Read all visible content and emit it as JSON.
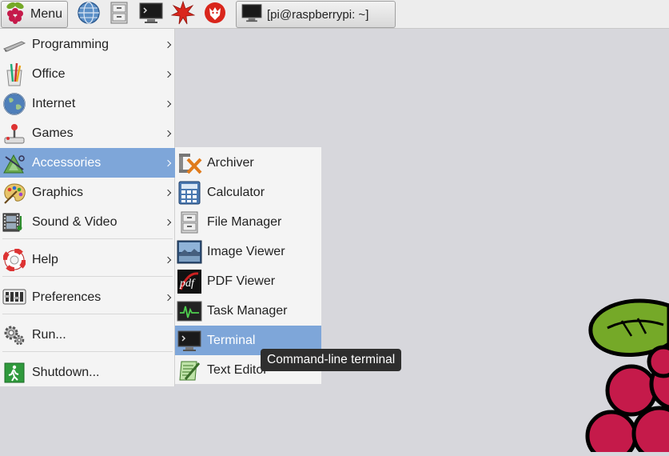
{
  "taskbar": {
    "menu_label": "Menu",
    "launchers": [
      "globe-icon",
      "file-cabinet-icon",
      "terminal-icon",
      "mathematica-star-icon",
      "wolfram-icon"
    ],
    "task_label": "[pi@raspberrypi: ~]"
  },
  "main_menu": {
    "items": [
      {
        "label": "Programming",
        "icon": "programming-icon",
        "submenu": true
      },
      {
        "label": "Office",
        "icon": "office-icon",
        "submenu": true
      },
      {
        "label": "Internet",
        "icon": "globe-icon",
        "submenu": true
      },
      {
        "label": "Games",
        "icon": "joystick-icon",
        "submenu": true
      },
      {
        "label": "Accessories",
        "icon": "accessories-icon",
        "submenu": true,
        "selected": true
      },
      {
        "label": "Graphics",
        "icon": "palette-icon",
        "submenu": true
      },
      {
        "label": "Sound & Video",
        "icon": "film-icon",
        "submenu": true
      },
      {
        "label": "Help",
        "icon": "lifebuoy-icon",
        "submenu": true
      },
      {
        "label": "Preferences",
        "icon": "preferences-icon",
        "submenu": true
      },
      {
        "label": "Run...",
        "icon": "gears-icon",
        "submenu": false
      },
      {
        "label": "Shutdown...",
        "icon": "exit-icon",
        "submenu": false
      }
    ]
  },
  "accessories_menu": {
    "items": [
      {
        "label": "Archiver",
        "icon": "archiver-icon"
      },
      {
        "label": "Calculator",
        "icon": "calculator-icon"
      },
      {
        "label": "File Manager",
        "icon": "file-cabinet-icon"
      },
      {
        "label": "Image Viewer",
        "icon": "image-icon"
      },
      {
        "label": "PDF Viewer",
        "icon": "pdf-icon"
      },
      {
        "label": "Task Manager",
        "icon": "task-manager-icon"
      },
      {
        "label": "Terminal",
        "icon": "terminal-icon",
        "selected": true
      },
      {
        "label": "Text Editor",
        "icon": "text-editor-icon"
      }
    ]
  },
  "tooltip": {
    "text": "Command-line terminal"
  },
  "colors": {
    "selection": "#7ea6d9",
    "desktop": "#d7d7dc",
    "raspberry": "#c51a4a",
    "leaf": "#75a928"
  }
}
